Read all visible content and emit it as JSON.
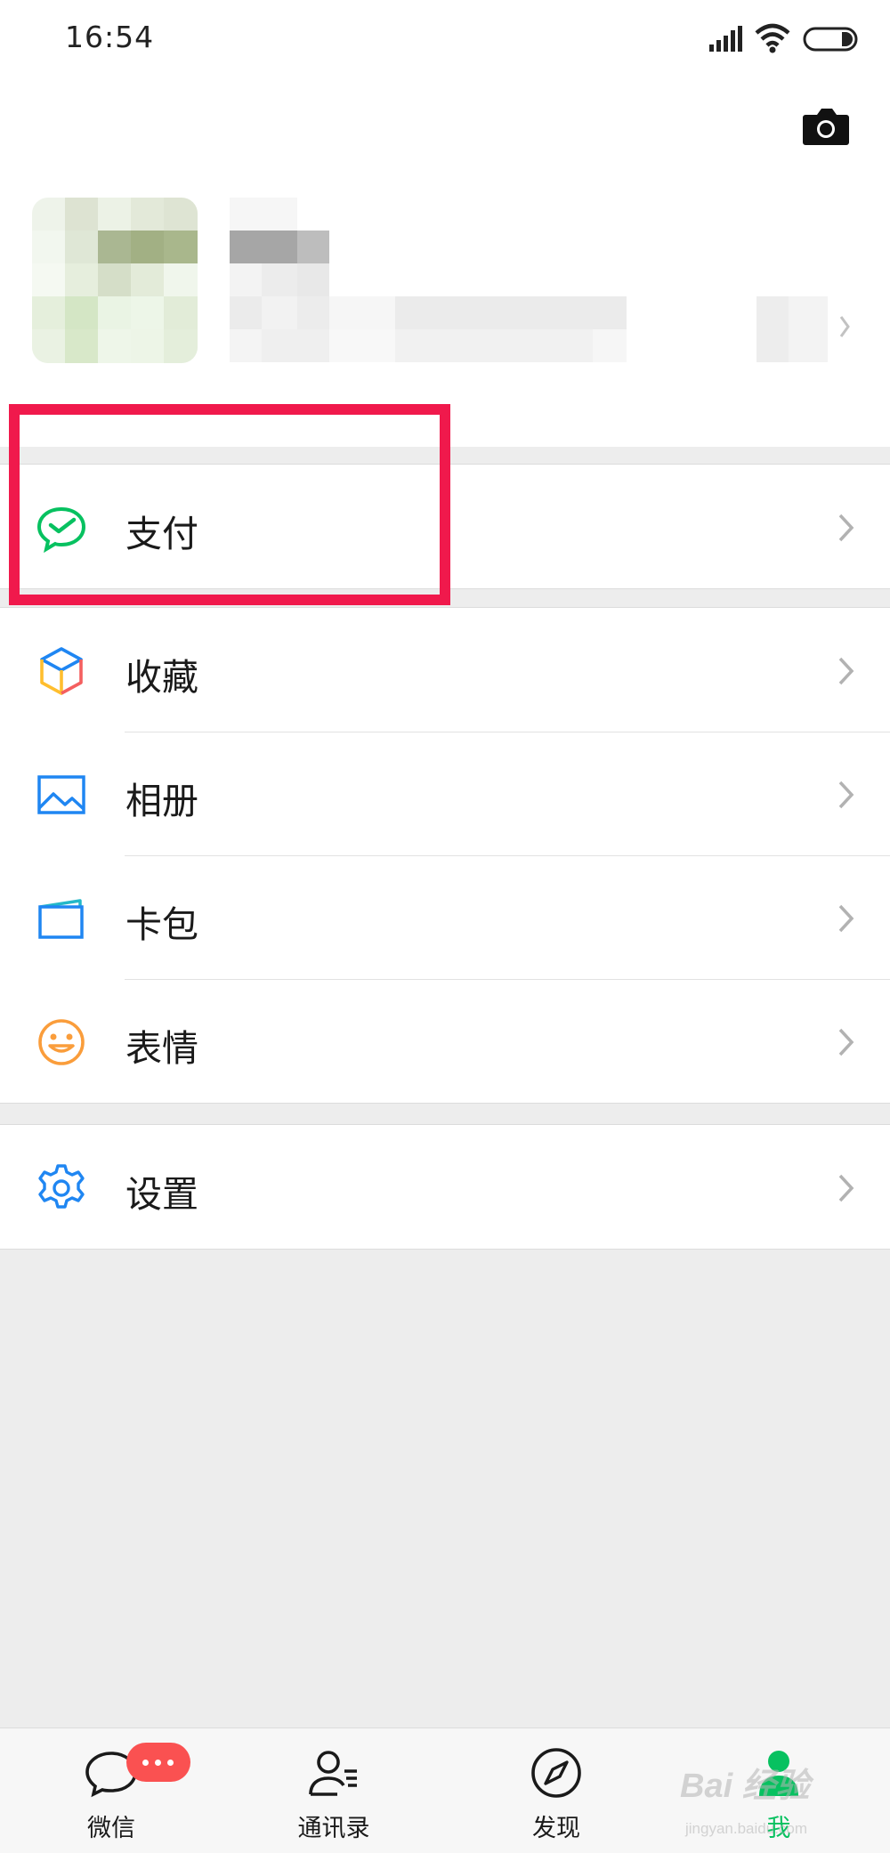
{
  "status_bar": {
    "time": "16:54",
    "icons": [
      "signal-icon",
      "wifi-icon",
      "battery-icon"
    ]
  },
  "header": {
    "camera_icon": "camera-icon"
  },
  "profile": {
    "avatar": "avatar",
    "chevron_icon": "chevron-right-icon"
  },
  "menu": {
    "pay": {
      "label": "支付",
      "icon": "wechat-pay-icon",
      "color": "#07c160"
    },
    "items": [
      {
        "label": "收藏",
        "icon": "favorites-cube-icon"
      },
      {
        "label": "相册",
        "icon": "album-icon"
      },
      {
        "label": "卡包",
        "icon": "card-wallet-icon"
      },
      {
        "label": "表情",
        "icon": "emoji-icon"
      }
    ],
    "settings": {
      "label": "设置",
      "icon": "gear-icon"
    }
  },
  "highlight_color": "#f0194c",
  "tabbar": {
    "tabs": [
      {
        "label": "微信",
        "icon": "chat-bubble-icon",
        "badge": "···"
      },
      {
        "label": "通讯录",
        "icon": "contacts-icon"
      },
      {
        "label": "发现",
        "icon": "compass-icon"
      },
      {
        "label": "我",
        "icon": "me-person-icon",
        "active": true
      }
    ],
    "active_color": "#07c160"
  },
  "watermark": {
    "text": "Bai 经验",
    "sub": "jingyan.baidu.com"
  }
}
